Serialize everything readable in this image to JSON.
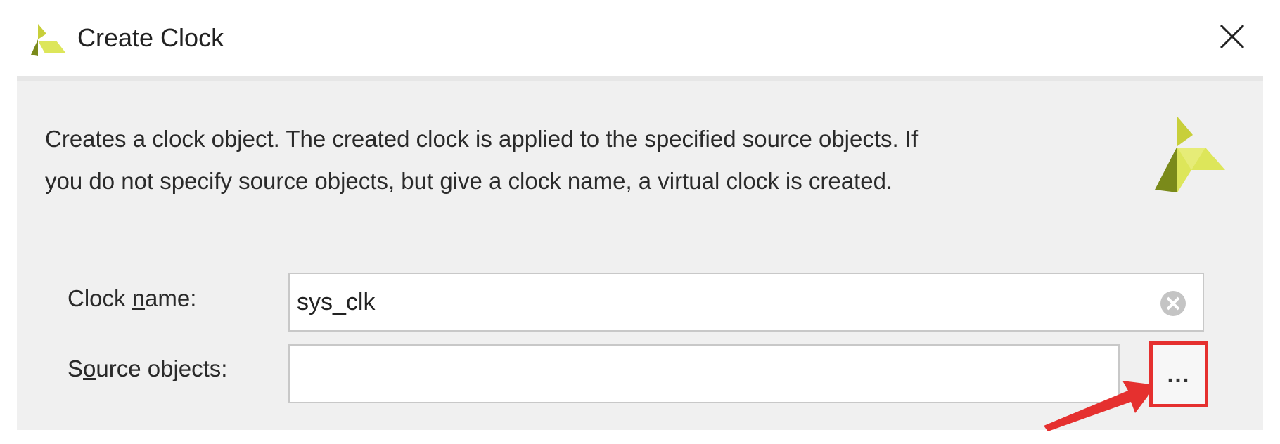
{
  "window": {
    "title": "Create Clock",
    "close_icon": "close-icon",
    "logo_icon": "xilinx-logo-icon"
  },
  "description": {
    "line1": "Creates a clock object. The created clock is applied to the specified source objects. If",
    "line2": "you do not specify source objects, but give a clock name, a virtual clock is created."
  },
  "fields": {
    "clock_name": {
      "label_before": "Clock ",
      "label_mnemonic": "n",
      "label_after": "ame:",
      "value": "sys_clk",
      "clear_icon": "clear-circle-icon"
    },
    "source_objects": {
      "label_before": "S",
      "label_mnemonic": "o",
      "label_after": "urce objects:",
      "value": "",
      "browse_label": "…"
    }
  },
  "colors": {
    "highlight": "#e5302f",
    "logo_dark": "#7a8a1a",
    "logo_light": "#d4e04a"
  }
}
